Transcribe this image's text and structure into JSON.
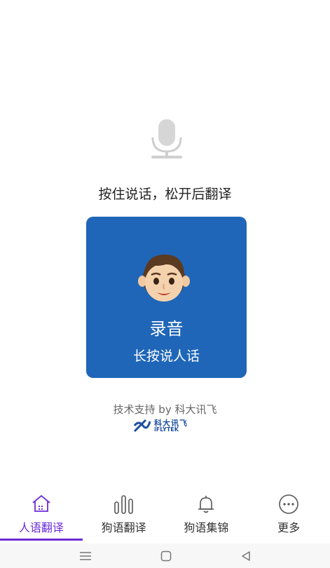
{
  "prompt": "按住说话，松开后翻译",
  "record_card": {
    "title": "录音",
    "subtitle": "长按说人话"
  },
  "support": {
    "text": "技术支持 by 科大讯飞",
    "logo_cn": "科大讯飞",
    "logo_en": "iFLYTEK"
  },
  "tabs": [
    {
      "label": "人语翻译",
      "icon": "home-icon",
      "active": true
    },
    {
      "label": "狗语翻译",
      "icon": "bars-icon",
      "active": false
    },
    {
      "label": "狗语集锦",
      "icon": "bell-icon",
      "active": false
    },
    {
      "label": "更多",
      "icon": "more-icon",
      "active": false
    }
  ],
  "colors": {
    "card": "#1f66b8",
    "active_tab": "#6c2bd9"
  }
}
